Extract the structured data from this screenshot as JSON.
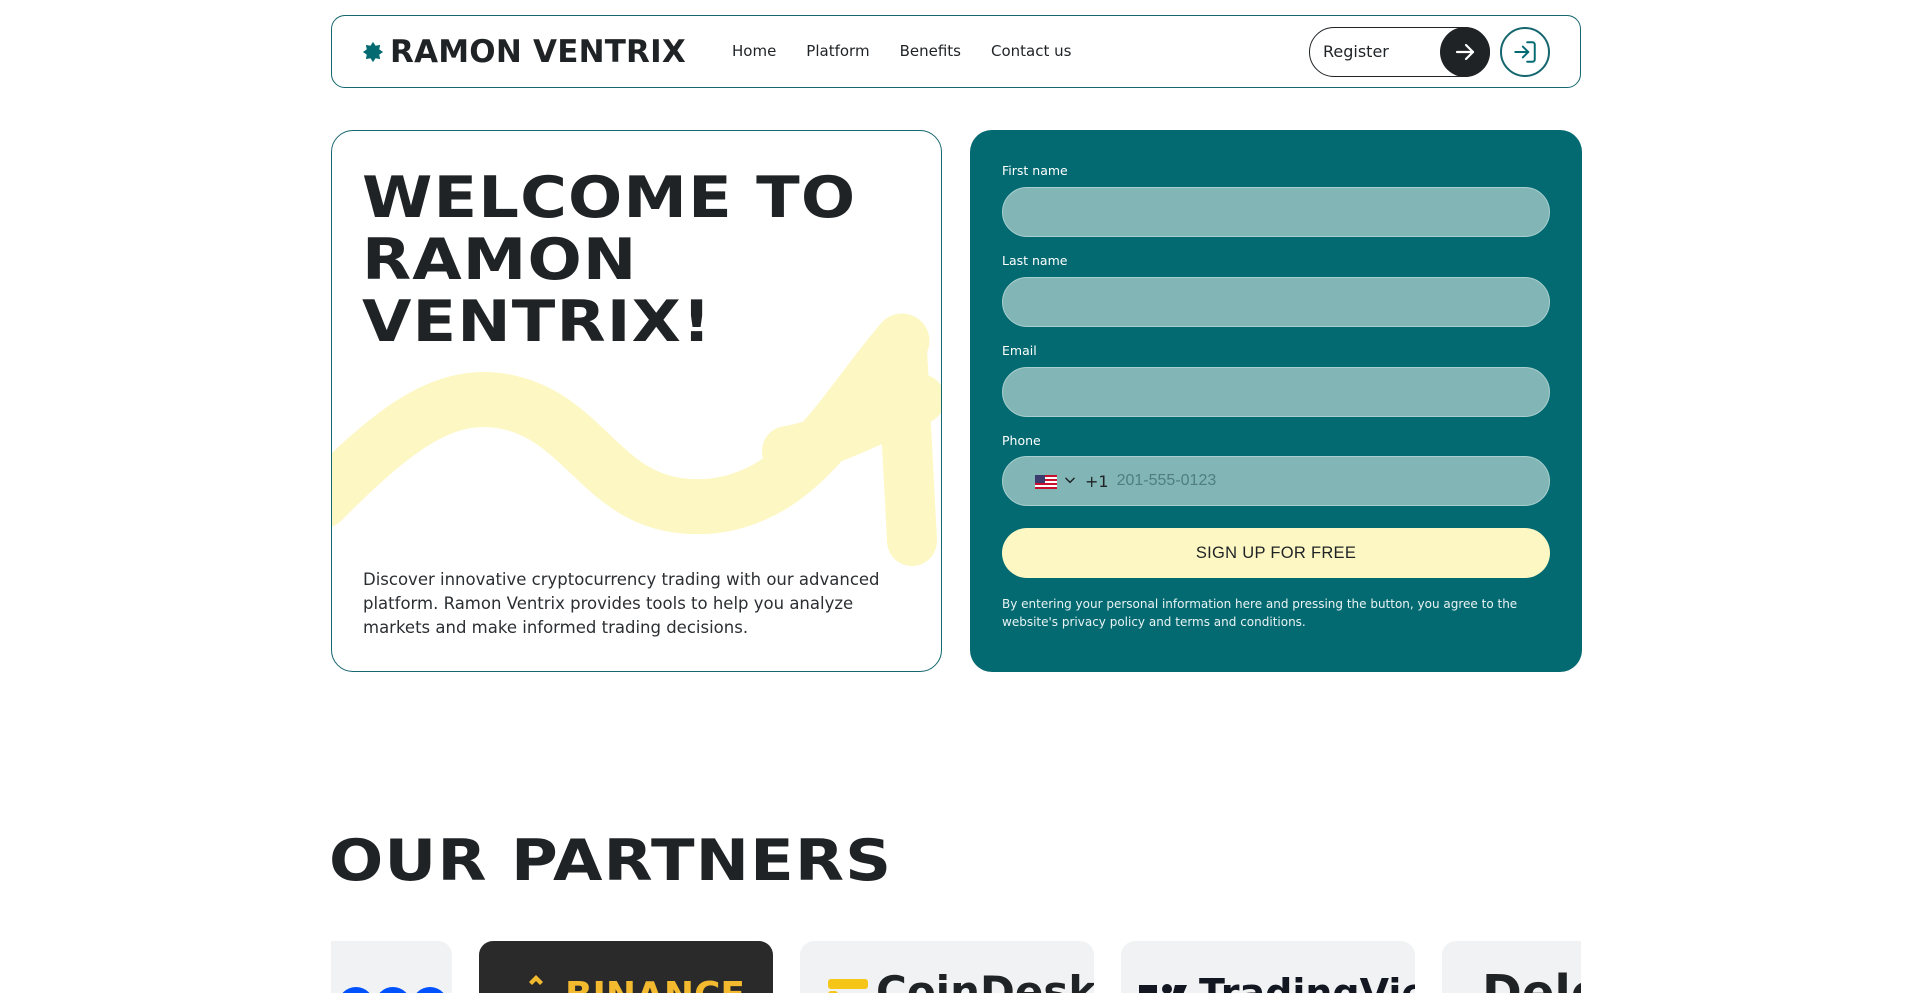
{
  "brand": {
    "name": "RAMON VENTRIX",
    "accent": "#046a72",
    "highlight": "#fdf7c3"
  },
  "nav": {
    "items": [
      "Home",
      "Platform",
      "Benefits",
      "Contact us"
    ]
  },
  "header": {
    "register_label": "Register"
  },
  "hero": {
    "title": "WELCOME TO\nRAMON\nVENTRIX!",
    "description": "Discover innovative cryptocurrency trading with our advanced platform. Ramon Ventrix provides tools to help you analyze markets and make informed trading decisions."
  },
  "form": {
    "first_name_label": "First name",
    "last_name_label": "Last name",
    "email_label": "Email",
    "phone_label": "Phone",
    "phone_dial_code": "+1",
    "phone_placeholder": "201-555-0123",
    "phone_country_icon": "us-flag-icon",
    "submit_label": "SIGN UP FOR FREE",
    "disclaimer": "By entering your personal information here and pressing the button, you agree to the website's privacy policy and terms and conditions."
  },
  "partners": {
    "title": "OUR PARTNERS",
    "items": [
      {
        "name": "coinbase",
        "visible_text": "",
        "color": "#0052ff"
      },
      {
        "name": "binance",
        "visible_text": "BINANCE",
        "color": "#f3ba2f"
      },
      {
        "name": "coindesk",
        "visible_text": "CoinDesk",
        "color": "#1f2326"
      },
      {
        "name": "tradingview",
        "visible_text": "TradingView",
        "color": "#131722"
      },
      {
        "name": "partner",
        "visible_text": "Dele",
        "color": "#1f2326"
      }
    ]
  }
}
